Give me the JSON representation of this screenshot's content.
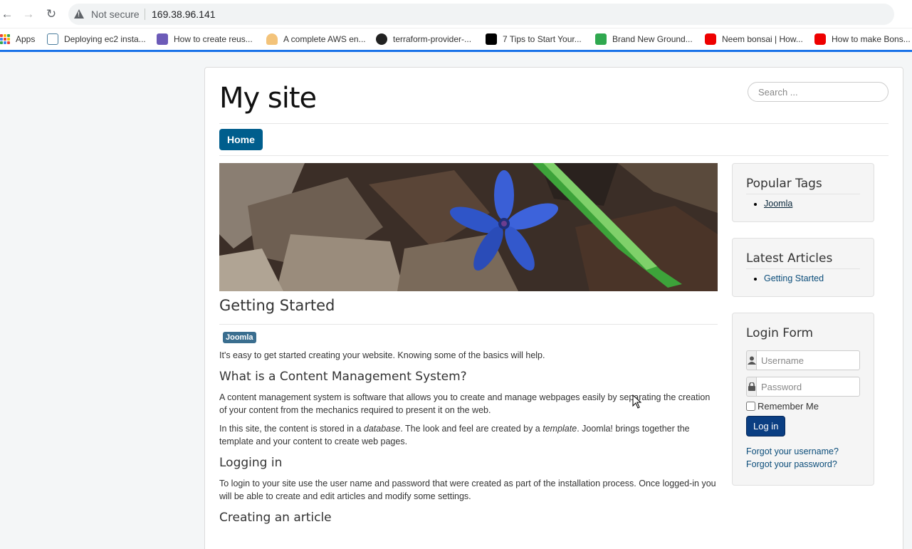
{
  "browser": {
    "security_label": "Not secure",
    "url": "169.38.96.141",
    "bookmarks": [
      {
        "label": "Apps",
        "icon": "apps-grid-icon"
      },
      {
        "label": "Deploying ec2 insta...",
        "icon": "doc-icon"
      },
      {
        "label": "How to create reus...",
        "icon": "heroku-icon"
      },
      {
        "label": "A complete AWS en...",
        "icon": "cloud-icon"
      },
      {
        "label": "terraform-provider-...",
        "icon": "github-icon"
      },
      {
        "label": "7 Tips to Start Your...",
        "icon": "medium-icon"
      },
      {
        "label": "Brand New Ground...",
        "icon": "house-icon"
      },
      {
        "label": "Neem bonsai | How...",
        "icon": "youtube-icon"
      },
      {
        "label": "How to make Bons...",
        "icon": "youtube-icon"
      }
    ]
  },
  "site": {
    "title": "My site",
    "search_placeholder": "Search ...",
    "nav_home": "Home"
  },
  "article": {
    "title": "Getting Started",
    "tag": "Joomla",
    "intro": "It's easy to get started creating your website. Knowing some of the basics will help.",
    "h_cms": "What is a Content Management System?",
    "p_cms": "A content management system is software that allows you to create and manage webpages easily by separating the creation of your content from the mechanics required to present it on the web.",
    "p_db_1": "In this site, the content is stored in a ",
    "p_db_em1": "database",
    "p_db_2": ". The look and feel are created by a ",
    "p_db_em2": "template",
    "p_db_3": ". Joomla! brings together the template and your content to create web pages.",
    "h_login": "Logging in",
    "p_login": "To login to your site use the user name and password that were created as part of the installation process. Once logged-in you will be able to create and edit articles and modify some settings.",
    "h_create": "Creating an article"
  },
  "sidebar": {
    "popular_tags_title": "Popular Tags",
    "popular_tag_1": "Joomla",
    "latest_title": "Latest Articles",
    "latest_1": "Getting Started",
    "login_title": "Login Form",
    "username_placeholder": "Username",
    "password_placeholder": "Password",
    "remember_label": "Remember Me",
    "login_button": "Log in",
    "forgot_username": "Forgot your username?",
    "forgot_password": "Forgot your password?"
  },
  "colors": {
    "browser_accent": "#1a73e8",
    "nav_active": "#005e8d",
    "login_button": "#0a3e82",
    "tag_badge": "#3a6e8f"
  }
}
